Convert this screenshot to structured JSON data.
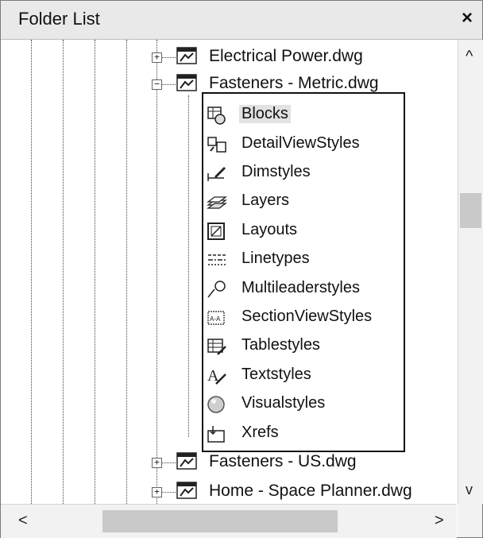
{
  "window": {
    "title": "Folder List",
    "close_symbol": "×"
  },
  "tree": {
    "files": [
      {
        "label": "Electrical Power.dwg",
        "expander": "+"
      },
      {
        "label": "Fasteners - Metric.dwg",
        "expander": "−"
      },
      {
        "label": "Fasteners - US.dwg",
        "expander": "+"
      },
      {
        "label": "Home - Space Planner.dwg",
        "expander": "+"
      }
    ],
    "children": [
      {
        "label": "Blocks",
        "icon": "blocks-icon"
      },
      {
        "label": "DetailViewStyles",
        "icon": "detail-view-styles-icon"
      },
      {
        "label": "Dimstyles",
        "icon": "dimstyles-icon"
      },
      {
        "label": "Layers",
        "icon": "layers-icon"
      },
      {
        "label": "Layouts",
        "icon": "layouts-icon"
      },
      {
        "label": "Linetypes",
        "icon": "linetypes-icon"
      },
      {
        "label": "Multileaderstyles",
        "icon": "multileader-icon"
      },
      {
        "label": "SectionViewStyles",
        "icon": "section-view-styles-icon"
      },
      {
        "label": "Tablestyles",
        "icon": "tablestyles-icon"
      },
      {
        "label": "Textstyles",
        "icon": "textstyles-icon"
      },
      {
        "label": "Visualstyles",
        "icon": "visualstyles-icon"
      },
      {
        "label": "Xrefs",
        "icon": "xrefs-icon"
      }
    ],
    "selected_child": "Blocks"
  },
  "scrollbars": {
    "up": "^",
    "down": "v",
    "left": "<",
    "right": ">"
  }
}
